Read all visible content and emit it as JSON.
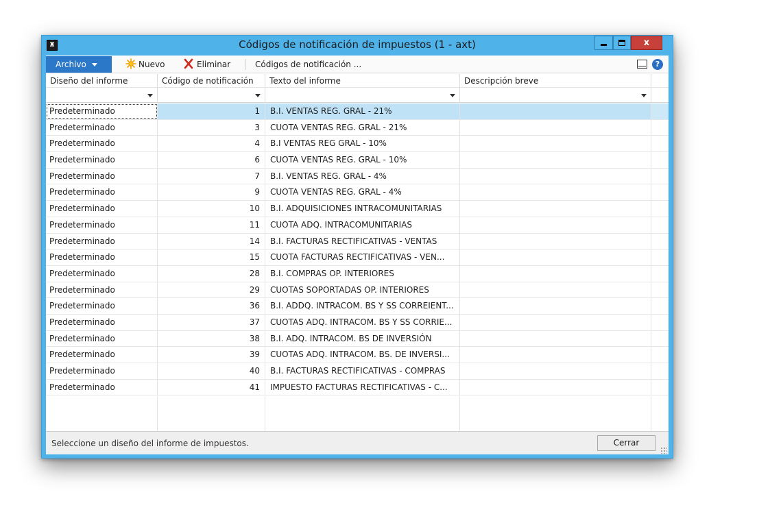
{
  "window": {
    "app_icon": "axapta-icon",
    "title": "Códigos de notificación de impuestos (1 - axt)",
    "close_glyph": "x"
  },
  "toolbar": {
    "archivo_label": "Archivo",
    "nuevo_label": "Nuevo",
    "eliminar_label": "Eliminar",
    "codigos_label": "Códigos de notificación ...",
    "help_glyph": "?"
  },
  "grid": {
    "columns": [
      "Diseño del informe",
      "Código de notificación",
      "Texto del informe",
      "Descripción breve"
    ],
    "rows": [
      {
        "design": "Predeterminado",
        "code": "1",
        "text": "B.I. VENTAS REG. GRAL - 21%",
        "desc": ""
      },
      {
        "design": "Predeterminado",
        "code": "3",
        "text": "CUOTA VENTAS REG. GRAL - 21%",
        "desc": ""
      },
      {
        "design": "Predeterminado",
        "code": "4",
        "text": "B.I VENTAS REG GRAL - 10%",
        "desc": ""
      },
      {
        "design": "Predeterminado",
        "code": "6",
        "text": "CUOTA VENTAS REG. GRAL - 10%",
        "desc": ""
      },
      {
        "design": "Predeterminado",
        "code": "7",
        "text": "B.I. VENTAS REG. GRAL - 4%",
        "desc": ""
      },
      {
        "design": "Predeterminado",
        "code": "9",
        "text": "CUOTA VENTAS REG. GRAL - 4%",
        "desc": ""
      },
      {
        "design": "Predeterminado",
        "code": "10",
        "text": "B.I. ADQUISICIONES INTRACOMUNITARIAS",
        "desc": ""
      },
      {
        "design": "Predeterminado",
        "code": "11",
        "text": "CUOTA ADQ. INTRACOMUNITARIAS",
        "desc": ""
      },
      {
        "design": "Predeterminado",
        "code": "14",
        "text": "B.I. FACTURAS RECTIFICATIVAS - VENTAS",
        "desc": ""
      },
      {
        "design": "Predeterminado",
        "code": "15",
        "text": "CUOTA FACTURAS RECTIFICATIVAS - VEN...",
        "desc": ""
      },
      {
        "design": "Predeterminado",
        "code": "28",
        "text": "B.I. COMPRAS OP. INTERIORES",
        "desc": ""
      },
      {
        "design": "Predeterminado",
        "code": "29",
        "text": "CUOTAS SOPORTADAS OP. INTERIORES",
        "desc": ""
      },
      {
        "design": "Predeterminado",
        "code": "36",
        "text": "B.I. ADDQ. INTRACOM. BS Y SS CORREIENT...",
        "desc": ""
      },
      {
        "design": "Predeterminado",
        "code": "37",
        "text": "CUOTAS ADQ. INTRACOM. BS Y SS CORRIE...",
        "desc": ""
      },
      {
        "design": "Predeterminado",
        "code": "38",
        "text": "B.I. ADQ. INTRACOM. BS DE INVERSIÓN",
        "desc": ""
      },
      {
        "design": "Predeterminado",
        "code": "39",
        "text": "CUOTAS ADQ. INTRACOM. BS. DE INVERSI...",
        "desc": ""
      },
      {
        "design": "Predeterminado",
        "code": "40",
        "text": "B.I. FACTURAS RECTIFICATIVAS - COMPRAS",
        "desc": ""
      },
      {
        "design": "Predeterminado",
        "code": "41",
        "text": "IMPUESTO FACTURAS RECTIFICATIVAS - C...",
        "desc": ""
      }
    ],
    "selected_row": 0
  },
  "status": {
    "text": "Seleccione un diseño del informe de impuestos.",
    "close_button": "Cerrar"
  },
  "colors": {
    "window_frame": "#4fb3e9",
    "archivo_bg": "#2c78c8",
    "close_bg": "#c8403a",
    "selected_row": "#bfe2f6"
  }
}
